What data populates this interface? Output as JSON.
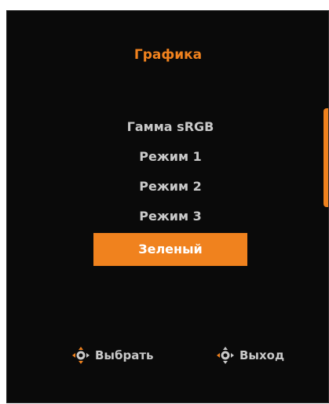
{
  "osd": {
    "title": "Графика",
    "items": [
      {
        "label": "Гамма sRGB",
        "selected": false
      },
      {
        "label": "Режим 1",
        "selected": false
      },
      {
        "label": "Режим 2",
        "selected": false
      },
      {
        "label": "Режим 3",
        "selected": false
      },
      {
        "label": "Зеленый",
        "selected": true
      }
    ],
    "footer": {
      "select_label": "Выбрать",
      "select_icon": "joystick-icon",
      "exit_label": "Выход",
      "exit_icon": "joystick-icon"
    }
  },
  "colors": {
    "accent": "#f0821e",
    "background": "#0a0a0a",
    "text": "#c9c9c9"
  }
}
